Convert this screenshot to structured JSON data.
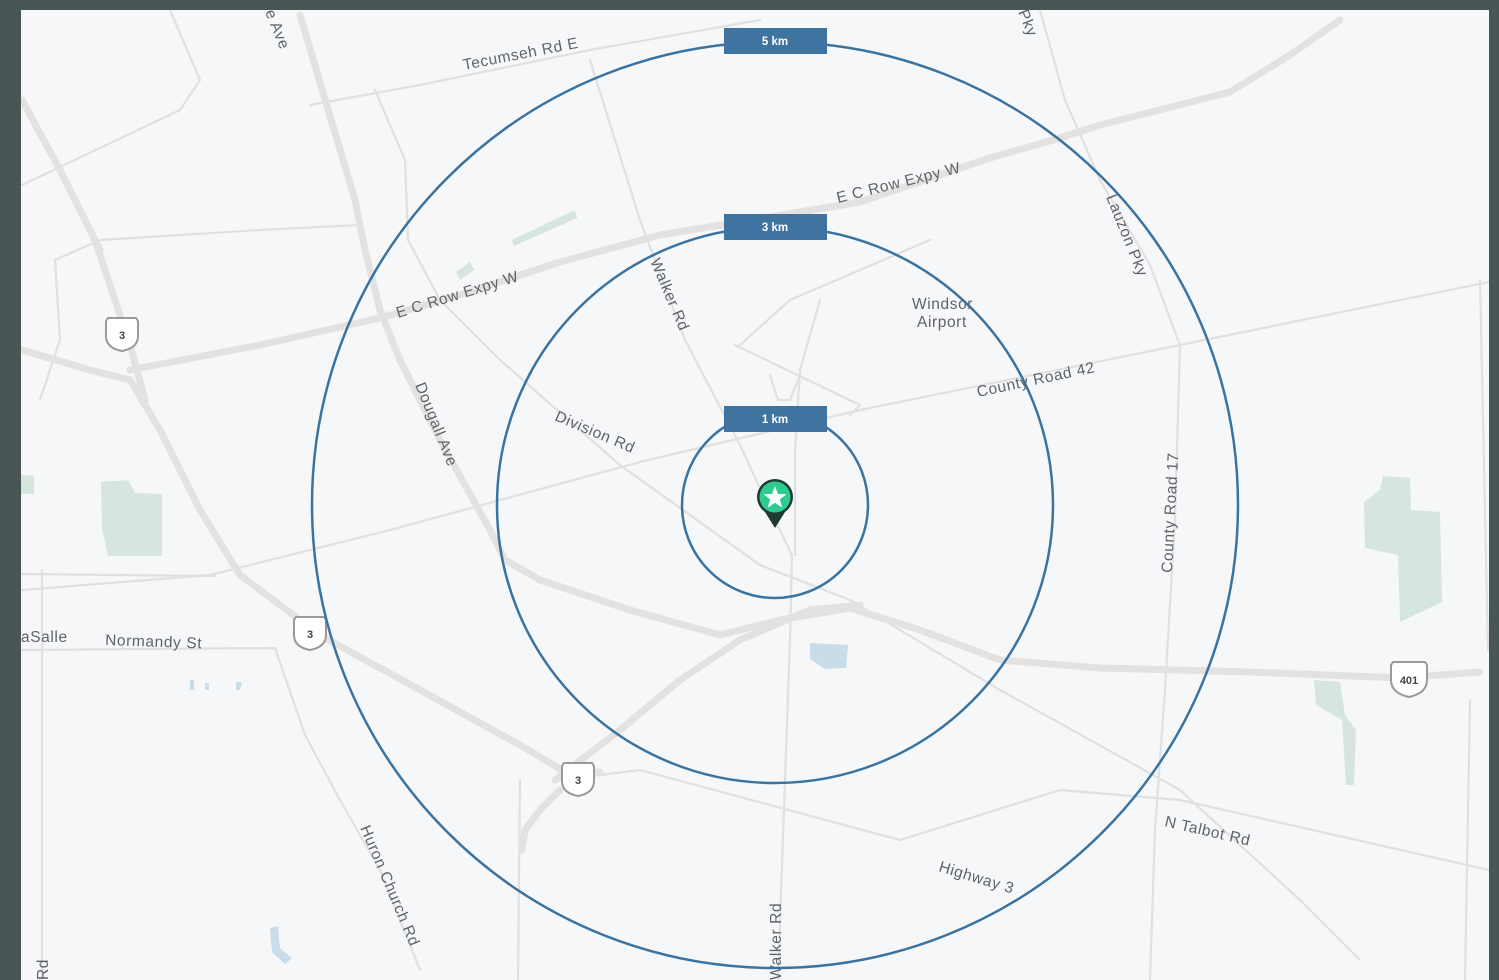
{
  "map": {
    "radius_rings": [
      {
        "label": "1 km"
      },
      {
        "label": "3 km"
      },
      {
        "label": "5 km"
      }
    ],
    "ring_color": "#3b73a0",
    "marker": {
      "icon": "star-pin-icon",
      "color": "#2ecc8f"
    },
    "labels": {
      "tecumseh": "Tecumseh Rd E",
      "ecrow_upper": "E C Row Expy W",
      "ecrow_lower": "E C Row Expy W",
      "walker_upper": "Walker Rd",
      "walker_lower": "Walker Rd",
      "windsor_airport_1": "Windsor",
      "windsor_airport_2": "Airport",
      "county42": "County Road 42",
      "lauzon": "Lauzon Pky",
      "lauzon_top": "Pky",
      "division": "Division Rd",
      "dougall": "Dougall Ave",
      "county17": "County Road 17",
      "ave_top": "e Ave",
      "lasalle": "aSalle",
      "normandy": "Normandy St",
      "talbot": "N Talbot Rd",
      "highway3": "Highway 3",
      "huron": "Huron Church Rd",
      "rd_left": "Rd"
    },
    "shields": {
      "hwy3_a": "3",
      "hwy3_b": "3",
      "hwy3_c": "3",
      "hwy401": "401"
    }
  }
}
